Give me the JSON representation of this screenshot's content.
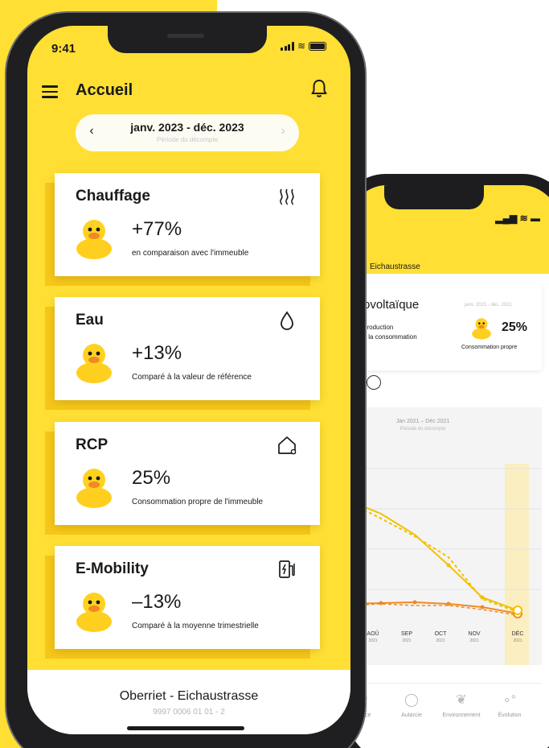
{
  "colors": {
    "brand_yellow": "#ffdf33",
    "tile_shadow": "#f6c618",
    "accent_orange": "#f08a24",
    "frame": "#1f1f21"
  },
  "status": {
    "time": "9:41"
  },
  "header": {
    "title": "Accueil",
    "menu_icon": "hamburger-menu-icon",
    "bell_icon": "bell-icon"
  },
  "period": {
    "label": "janv. 2023 - déc. 2023",
    "caption": "Période du décompte",
    "prev": "‹",
    "next": "›"
  },
  "tiles": [
    {
      "title": "Chauffage",
      "value": "+77%",
      "caption": "en comparaison avec l'immeuble",
      "icon": "heating-icon"
    },
    {
      "title": "Eau",
      "value": "+13%",
      "caption": "Comparé à la valeur de référence",
      "icon": "water-drop-icon"
    },
    {
      "title": "RCP",
      "value": "25%",
      "caption": "Consommation propre de l'immeuble",
      "icon": "house-icon"
    },
    {
      "title": "E-Mobility",
      "value": "–13%",
      "caption": "Comparé à la moyenne trimestrielle",
      "icon": "ev-charger-icon"
    }
  ],
  "footer": {
    "title": "Oberriet - Eichaustrasse",
    "subtitle": "9997 0006 01 01 - 2"
  },
  "back_phone": {
    "header_title": "Eichaustrasse",
    "card_title": "ovoltaïque",
    "line1": "production",
    "line2": "c la consommation",
    "period": "janv. 2021 - déc. 2021",
    "percent": "25%",
    "percent_caption": "Consommation propre",
    "chart_range": "Jan 2021 – Déc 2021",
    "chart_range_caption": "Période du décompte",
    "months": [
      {
        "label": "AOÛ",
        "year": "2021"
      },
      {
        "label": "SEP",
        "year": "2021"
      },
      {
        "label": "OCT",
        "year": "2021"
      },
      {
        "label": "NOV",
        "year": "2021"
      },
      {
        "label": "DÉC",
        "year": "2021"
      }
    ],
    "tabs": [
      {
        "label": "dance",
        "icon": "chart-icon"
      },
      {
        "label": "Autarcie",
        "icon": "autarky-icon"
      },
      {
        "label": "Environnement",
        "icon": "leaf-icon"
      },
      {
        "label": "Évolution",
        "icon": "evolution-icon"
      }
    ]
  }
}
